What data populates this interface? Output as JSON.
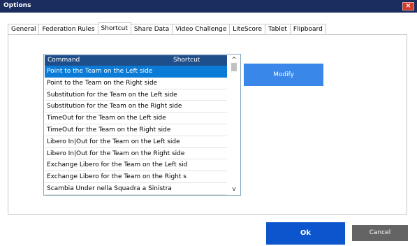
{
  "window": {
    "title": "Options",
    "close_symbol": "×"
  },
  "tabs": [
    {
      "label": "General"
    },
    {
      "label": "Federation Rules"
    },
    {
      "label": "Shortcut",
      "active": true
    },
    {
      "label": "Share Data"
    },
    {
      "label": "Video Challenge"
    },
    {
      "label": "LiteScore"
    },
    {
      "label": "Tablet"
    },
    {
      "label": "Flipboard"
    }
  ],
  "table": {
    "headers": {
      "command": "Command",
      "shortcut": "Shortcut"
    },
    "selected_index": 0,
    "rows": [
      "Point to the Team on the Left side",
      "Point to the Team on the Right side",
      "Substitution for the Team on the Left side",
      "Substitution for the Team on the Right side",
      "TimeOut for the Team on the Left side",
      "TimeOut for the Team on the Right side",
      "Libero In|Out for the Team on the Left side",
      "Libero In|Out for the Team on the Right side",
      "Exchange Libero for the Team on the Left sid",
      "Exchange Libero for the Team on the Right s",
      "Scambia Under nella Squadra a Sinistra"
    ]
  },
  "scrollbar": {
    "up_arrow": "^",
    "down_arrow": "v"
  },
  "buttons": {
    "modify": "Modify",
    "ok": "Ok",
    "cancel": "Cancel"
  },
  "colors": {
    "titlebar": "#1b2c5e",
    "header": "#1f4f8a",
    "selection": "#0a7bd6",
    "modify": "#3a87ea",
    "ok": "#0d55cc",
    "cancel": "#646464",
    "close": "#d23a2c"
  }
}
